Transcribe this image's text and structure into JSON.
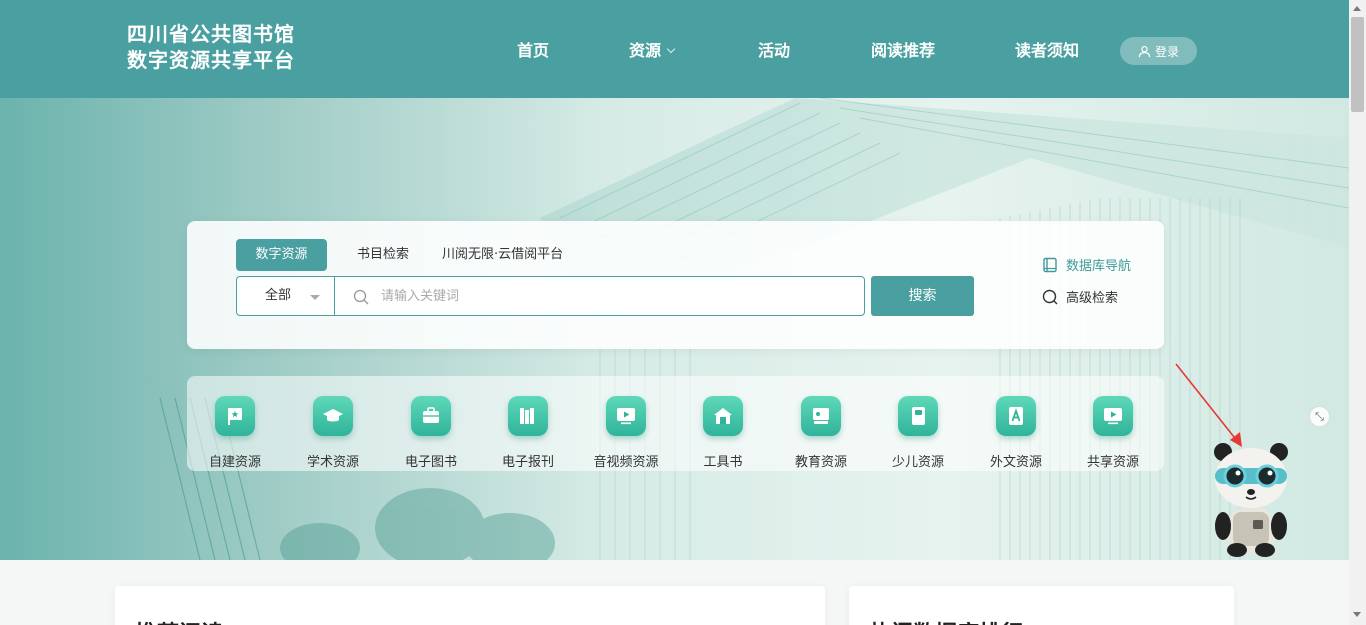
{
  "header": {
    "logo_line1": "四川省公共图书馆",
    "logo_line2": "数字资源共享平台",
    "nav": [
      "首页",
      "资源",
      "活动",
      "阅读推荐",
      "读者须知"
    ],
    "login_label": "登录"
  },
  "search": {
    "tabs": [
      "数字资源",
      "书目检索",
      "川阅无限·云借阅平台"
    ],
    "active_tab": "数字资源",
    "scope_value": "全部",
    "placeholder": "请输入关键词",
    "button_label": "搜索",
    "db_nav_label": "数据库导航",
    "advanced_label": "高级检索"
  },
  "categories": [
    "自建资源",
    "学术资源",
    "电子图书",
    "电子报刊",
    "音视频资源",
    "工具书",
    "教育资源",
    "少儿资源",
    "外文资源",
    "共享资源"
  ],
  "sections": [
    "推荐阅读",
    "热门数据库排行"
  ],
  "colors": {
    "brand": "#4a9fa0",
    "icon_green": "#2fb49a",
    "link_teal": "#3f9a98"
  }
}
